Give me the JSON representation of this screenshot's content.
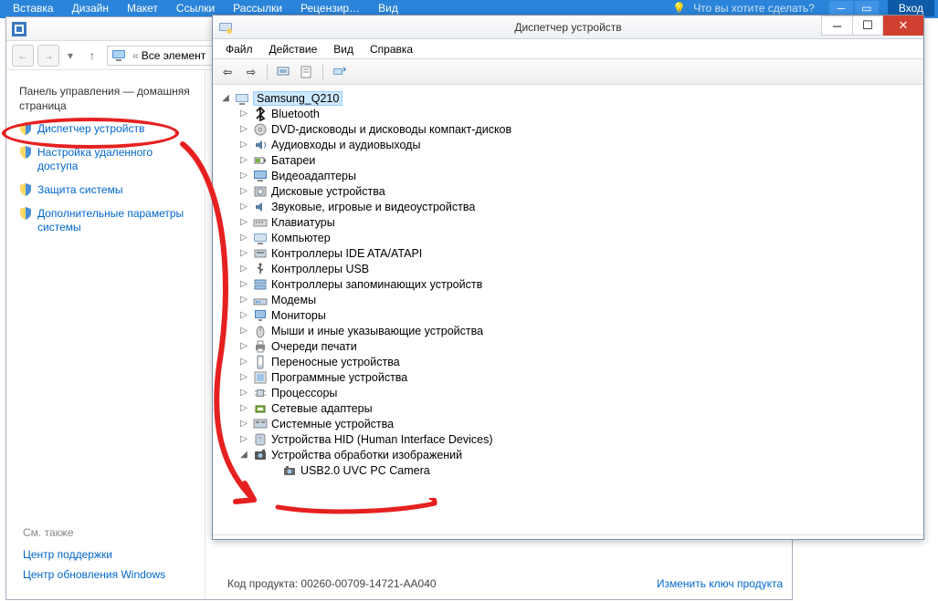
{
  "ribbon": {
    "tabs": [
      "Вставка",
      "Дизайн",
      "Макет",
      "Ссылки",
      "Рассылки",
      "Рецензир…",
      "Вид"
    ],
    "search_prefix": "♀",
    "search_placeholder": "Что вы хотите сделать?",
    "login": "Вход"
  },
  "cp": {
    "path_prefix": "«",
    "path_text": "Все элемент",
    "header": "Панель управления — домашняя страница",
    "items": [
      {
        "label": "Диспетчер устройств"
      },
      {
        "label": "Настройка удаленного доступа"
      },
      {
        "label": "Защита системы"
      },
      {
        "label": "Дополнительные параметры системы"
      }
    ],
    "footer_hdr": "См. также",
    "footer_links": [
      "Центр поддержки",
      "Центр обновления Windows"
    ],
    "product_key_label": "Код продукта:",
    "product_key": "00260-00709-14721-AA040",
    "change_key": "Изменить ключ продукта"
  },
  "dm": {
    "title": "Диспетчер устройств",
    "menu": [
      "Файл",
      "Действие",
      "Вид",
      "Справка"
    ],
    "root": "Samsung_Q210",
    "categories": [
      {
        "label": "Bluetooth",
        "icon": "bt"
      },
      {
        "label": "DVD-дисководы и дисководы компакт-дисков",
        "icon": "cd"
      },
      {
        "label": "Аудиовходы и аудиовыходы",
        "icon": "audio"
      },
      {
        "label": "Батареи",
        "icon": "battery"
      },
      {
        "label": "Видеоадаптеры",
        "icon": "display"
      },
      {
        "label": "Дисковые устройства",
        "icon": "disk"
      },
      {
        "label": "Звуковые, игровые и видеоустройства",
        "icon": "sound"
      },
      {
        "label": "Клавиатуры",
        "icon": "kbd"
      },
      {
        "label": "Компьютер",
        "icon": "pc"
      },
      {
        "label": "Контроллеры IDE ATA/ATAPI",
        "icon": "ide"
      },
      {
        "label": "Контроллеры USB",
        "icon": "usb"
      },
      {
        "label": "Контроллеры запоминающих устройств",
        "icon": "storage"
      },
      {
        "label": "Модемы",
        "icon": "modem"
      },
      {
        "label": "Мониторы",
        "icon": "monitor"
      },
      {
        "label": "Мыши и иные указывающие устройства",
        "icon": "mouse"
      },
      {
        "label": "Очереди печати",
        "icon": "print"
      },
      {
        "label": "Переносные устройства",
        "icon": "portable"
      },
      {
        "label": "Программные устройства",
        "icon": "soft"
      },
      {
        "label": "Процессоры",
        "icon": "cpu"
      },
      {
        "label": "Сетевые адаптеры",
        "icon": "net"
      },
      {
        "label": "Системные устройства",
        "icon": "sys"
      },
      {
        "label": "Устройства HID (Human Interface Devices)",
        "icon": "hid"
      },
      {
        "label": "Устройства обработки изображений",
        "icon": "img",
        "expanded": true,
        "children": [
          {
            "label": "USB2.0 UVC PC Camera",
            "icon": "cam"
          }
        ]
      }
    ]
  }
}
